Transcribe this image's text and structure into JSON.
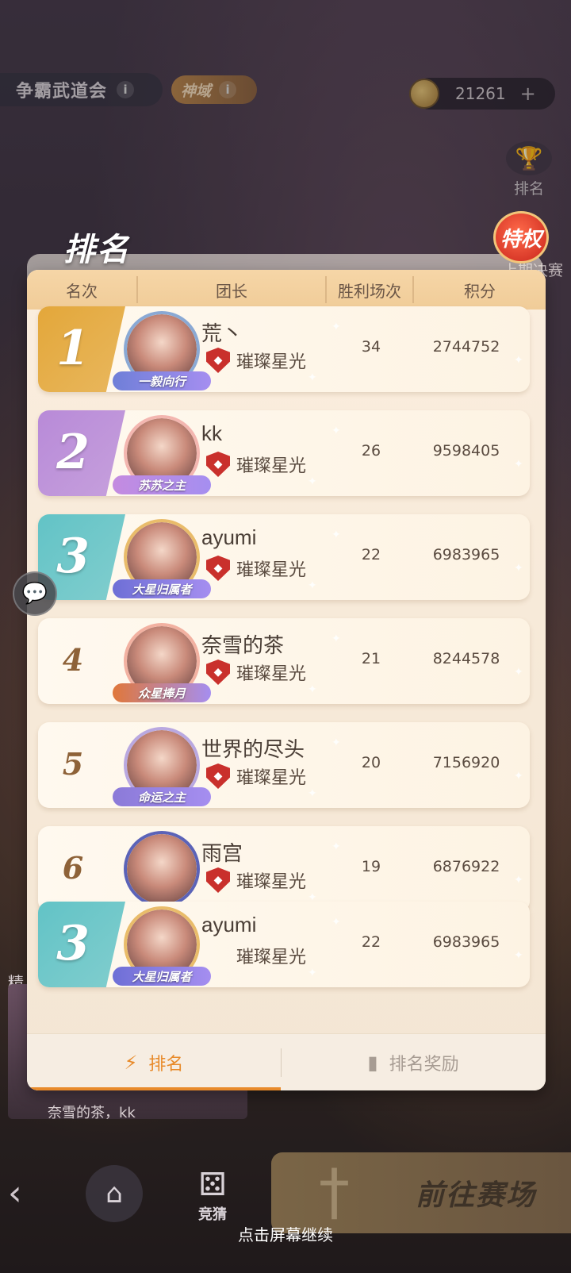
{
  "topbar": {
    "event_title": "争霸武道会",
    "domain_badge": "神域",
    "currency_value": "21261"
  },
  "side": {
    "rank_label": "排名",
    "privilege_label": "特权",
    "last_match_label": "上期决赛"
  },
  "panel": {
    "title": "排名",
    "columns": [
      "名次",
      "团长",
      "胜利场次",
      "积分"
    ],
    "rows": [
      {
        "rank": "1",
        "name": "荒丶",
        "guild": "璀璨星光",
        "wins": "34",
        "score": "2744752",
        "title": "一毅向行",
        "band": "#e3a73a",
        "frame": "#8aa9d4"
      },
      {
        "rank": "2",
        "name": "kk",
        "guild": "璀璨星光",
        "wins": "26",
        "score": "9598405",
        "title": "苏苏之主",
        "band": "#b88ad8",
        "frame": "#f3b6b0"
      },
      {
        "rank": "3",
        "name": "ayumi",
        "guild": "璀璨星光",
        "wins": "22",
        "score": "6983965",
        "title": "大星归属者",
        "band": "#62c3c6",
        "frame": "#e9bc6a"
      },
      {
        "rank": "4",
        "name": "奈雪的茶",
        "guild": "璀璨星光",
        "wins": "21",
        "score": "8244578",
        "title": "众星捧月",
        "band": "",
        "frame": "#f2b1a1"
      },
      {
        "rank": "5",
        "name": "世界的尽头",
        "guild": "璀璨星光",
        "wins": "20",
        "score": "7156920",
        "title": "命运之主",
        "band": "",
        "frame": "#b9a8e0"
      },
      {
        "rank": "6",
        "name": "雨宫",
        "guild": "璀璨星光",
        "wins": "19",
        "score": "6876922",
        "title": "",
        "band": "",
        "frame": "#5b63b8"
      }
    ],
    "self_row": {
      "rank": "3",
      "name": "ayumi",
      "guild": "璀璨星光",
      "wins": "22",
      "score": "6983965",
      "title": "大星归属者"
    },
    "tabs": {
      "rank": "排名",
      "reward": "排名奖励"
    }
  },
  "bottom": {
    "side_label": "精",
    "card_label": "奈雪的茶，kk",
    "guess_label": "竞猜",
    "go_arena_label": "前往赛场",
    "continue_hint": "点击屏幕继续"
  }
}
